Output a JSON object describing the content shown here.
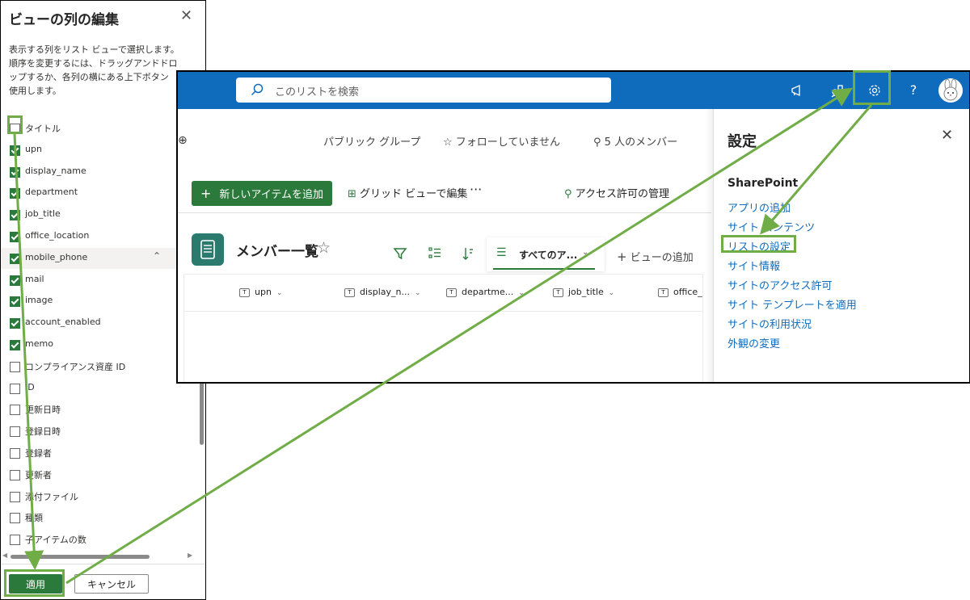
{
  "column_panel": {
    "title": "ビューの列の編集",
    "close_icon": "close-icon",
    "description_lines": [
      "表示する列をリスト ビューで選択します。",
      "順序を変更するには、ドラッグアンドドロ",
      "ップするか、各列の横にある上下ボタン",
      "使用します。"
    ],
    "columns": [
      {
        "label": "タイトル",
        "checked": false
      },
      {
        "label": "upn",
        "checked": true
      },
      {
        "label": "display_name",
        "checked": true
      },
      {
        "label": "department",
        "checked": true
      },
      {
        "label": "job_title",
        "checked": true
      },
      {
        "label": "office_location",
        "checked": true
      },
      {
        "label": "mobile_phone",
        "checked": true,
        "highlighted": true
      },
      {
        "label": "mail",
        "checked": true
      },
      {
        "label": "image",
        "checked": true
      },
      {
        "label": "account_enabled",
        "checked": true
      },
      {
        "label": "memo",
        "checked": true
      },
      {
        "label": "コンプライアンス資産 ID",
        "checked": false
      },
      {
        "label": "ID",
        "checked": false
      },
      {
        "label": "更新日時",
        "checked": false
      },
      {
        "label": "登録日時",
        "checked": false
      },
      {
        "label": "登録者",
        "checked": false
      },
      {
        "label": "更新者",
        "checked": false
      },
      {
        "label": "添付ファイル",
        "checked": false
      },
      {
        "label": "種類",
        "checked": false
      },
      {
        "label": "子アイテムの数",
        "checked": false
      }
    ],
    "apply_label": "適用",
    "cancel_label": "キャンセル"
  },
  "main": {
    "search_placeholder": "このリストを検索",
    "topbar_icons": [
      "megaphone-icon",
      "people-network-icon",
      "gear-icon",
      "help-icon",
      "avatar"
    ],
    "help_glyph": "?",
    "group_type": "パブリック グループ",
    "follow_label": "フォローしていません",
    "members_label": "5 人のメンバー",
    "new_item_label": "新しいアイテムを追加",
    "grid_edit_label": "グリッド ビューで編集",
    "more_label": "···",
    "access_label": "アクセス許可の管理",
    "list_title": "メンバー一覧",
    "view_tab_label": "すべてのア...",
    "add_view_label": "ビューの追加",
    "grid_columns": [
      "upn",
      "display_n...",
      "departme...",
      "job_title",
      "office_"
    ]
  },
  "settings": {
    "title": "設定",
    "section": "SharePoint",
    "links": [
      "アプリの追加",
      "サイト コンテンツ",
      "リストの設定",
      "サイト情報",
      "サイトのアクセス許可",
      "サイト テンプレートを適用",
      "サイトの利用状況",
      "外観の変更"
    ]
  },
  "colors": {
    "accent": "#2b7a3b",
    "topbar": "#0f6cbd",
    "annotation": "#70ad47",
    "link": "#0f6cbd"
  }
}
